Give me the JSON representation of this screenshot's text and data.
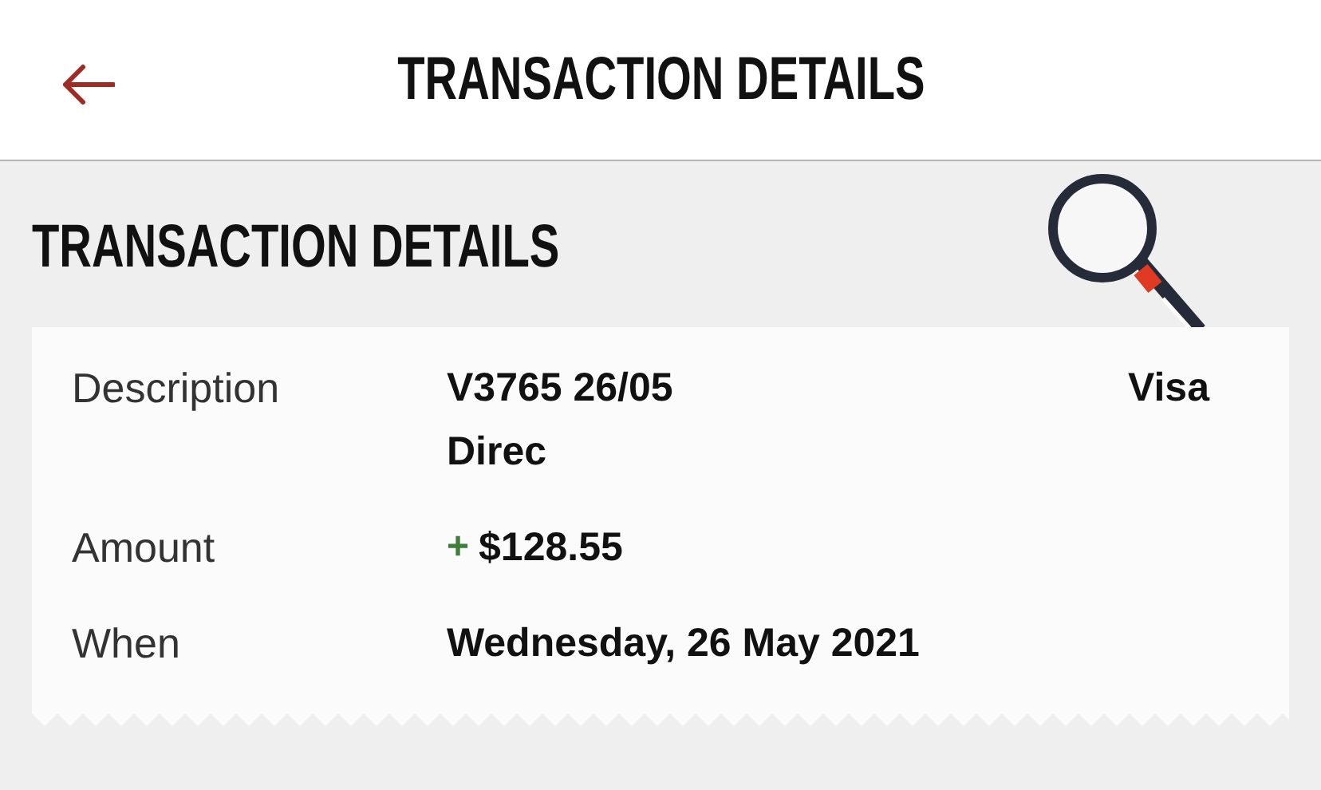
{
  "header": {
    "title": "TRANSACTION DETAILS"
  },
  "section": {
    "title": "TRANSACTION DETAILS"
  },
  "details": [
    {
      "kind": "description",
      "label": "Description",
      "lines": [
        "V3765 26/05",
        "Direc"
      ],
      "aside": "Visa"
    },
    {
      "kind": "amount",
      "label": "Amount",
      "sign": "+",
      "positive": true,
      "value": "$128.55"
    },
    {
      "kind": "text",
      "label": "When",
      "value": "Wednesday, 26 May 2021"
    }
  ]
}
